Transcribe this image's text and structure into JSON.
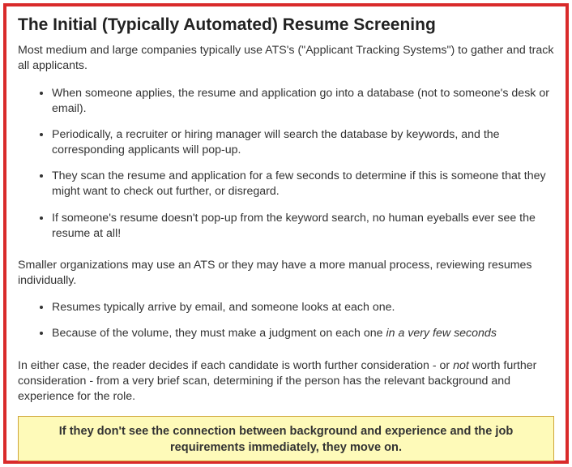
{
  "title": "The Initial (Typically Automated) Resume Screening",
  "intro": "Most medium and large companies typically use ATS's (\"Applicant Tracking Systems\") to gather and track all applicants.",
  "list1": {
    "item0": "When someone applies, the resume and application go into a database (not to someone's desk or email).",
    "item1": "Periodically, a recruiter or hiring manager will search the database by keywords, and the corresponding applicants will pop-up.",
    "item2": "They scan the resume and application for a few seconds to determine if this is someone that they might want to check out further, or disregard.",
    "item3": "If someone's resume doesn't pop-up from the keyword search, no human eyeballs ever see the resume at all!"
  },
  "para2": "Smaller organizations may use an ATS or they may have a more manual process, reviewing resumes individually.",
  "list2": {
    "item0": "Resumes typically arrive by email, and someone looks at each one.",
    "item1_prefix": "Because of the volume, they must make a judgment on each one ",
    "item1_italic": "in a very few seconds"
  },
  "para3_prefix": "In either case, the reader decides if each candidate is worth further consideration - or ",
  "para3_italic": "not",
  "para3_suffix": " worth further consideration - from a very brief scan, determining if the person has the relevant background and experience for the role.",
  "callout": "If they don't see the connection between background and experience and the job requirements immediately, they move on."
}
